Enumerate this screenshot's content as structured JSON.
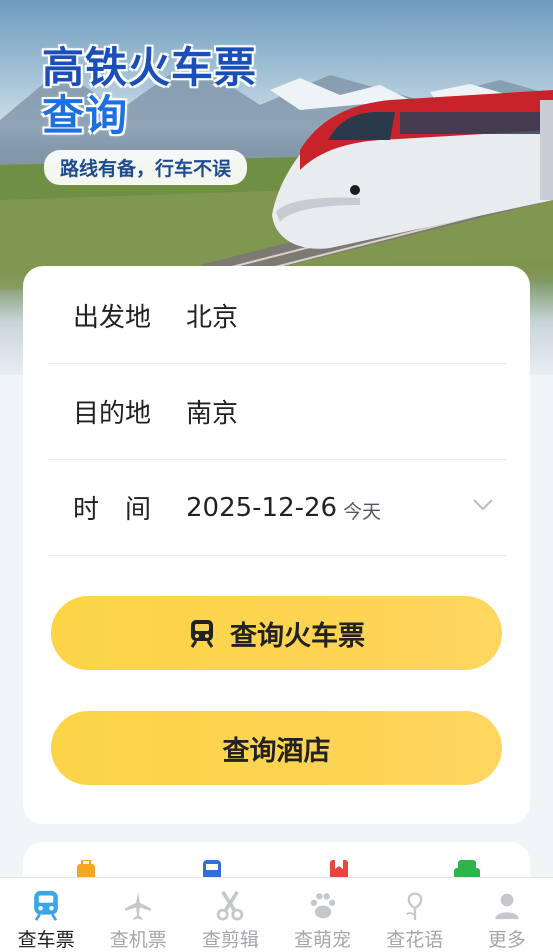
{
  "hero": {
    "title_line1": "高铁火车票",
    "title_line2": "查询",
    "subtitle": "路线有备，行车不误"
  },
  "form": {
    "departure_label": "出发地",
    "departure_value": "北京",
    "destination_label": "目的地",
    "destination_value": "南京",
    "date_label": "时　间",
    "date_value": "2025-12-26",
    "date_hint": "今天"
  },
  "buttons": {
    "search_train": "查询火车票",
    "search_hotel": "查询酒店"
  },
  "quick_icons": [
    "luggage-icon",
    "bus-icon",
    "bookmark-icon",
    "seat-icon"
  ],
  "tabs": [
    {
      "label": "查车票",
      "icon": "train-icon",
      "active": true
    },
    {
      "label": "查机票",
      "icon": "plane-icon",
      "active": false
    },
    {
      "label": "查剪辑",
      "icon": "scissors-icon",
      "active": false
    },
    {
      "label": "查萌宠",
      "icon": "paw-icon",
      "active": false
    },
    {
      "label": "查花语",
      "icon": "flower-icon",
      "active": false
    },
    {
      "label": "更多",
      "icon": "user-icon",
      "active": false
    }
  ],
  "colors": {
    "accent_yellow": "#fdd452",
    "title_blue": "#1b4fb8",
    "active_tab_icon": "#3aa6e8",
    "inactive": "#a3a7ad"
  }
}
